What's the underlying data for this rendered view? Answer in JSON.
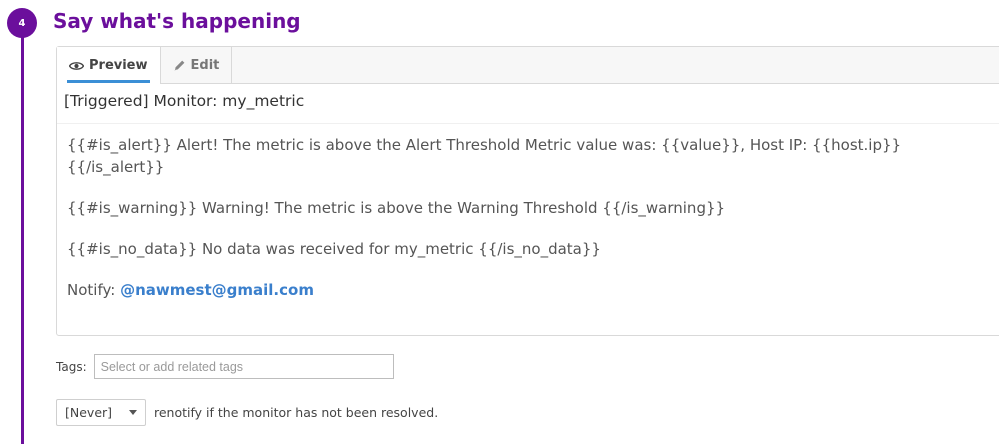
{
  "step": {
    "number": "4",
    "title": "Say what's happening"
  },
  "tabs": [
    {
      "label": "Preview",
      "icon": "eye-icon",
      "active": true
    },
    {
      "label": "Edit",
      "icon": "pencil-icon",
      "active": false
    }
  ],
  "message": {
    "subject": "[Triggered] Monitor: my_metric",
    "lines": [
      "{{#is_alert}} Alert! The metric is above the Alert Threshold Metric value was: {{value}}, Host IP: {{host.ip}} {{/is_alert}}",
      "{{#is_warning}} Warning! The metric is above the Warning Threshold {{/is_warning}}",
      "{{#is_no_data}} No data was received for my_metric {{/is_no_data}}"
    ],
    "notify_label": "Notify:",
    "notify_handle": "@nawmest@gmail.com"
  },
  "tags": {
    "label": "Tags:",
    "placeholder": "Select or add related tags",
    "value": ""
  },
  "renotify": {
    "selected": "[Never]",
    "text": "renotify if the monitor has not been resolved."
  },
  "colors": {
    "accent": "#6b0f9c",
    "link": "#3a7fcc",
    "tab_underline": "#3b8fd6"
  }
}
